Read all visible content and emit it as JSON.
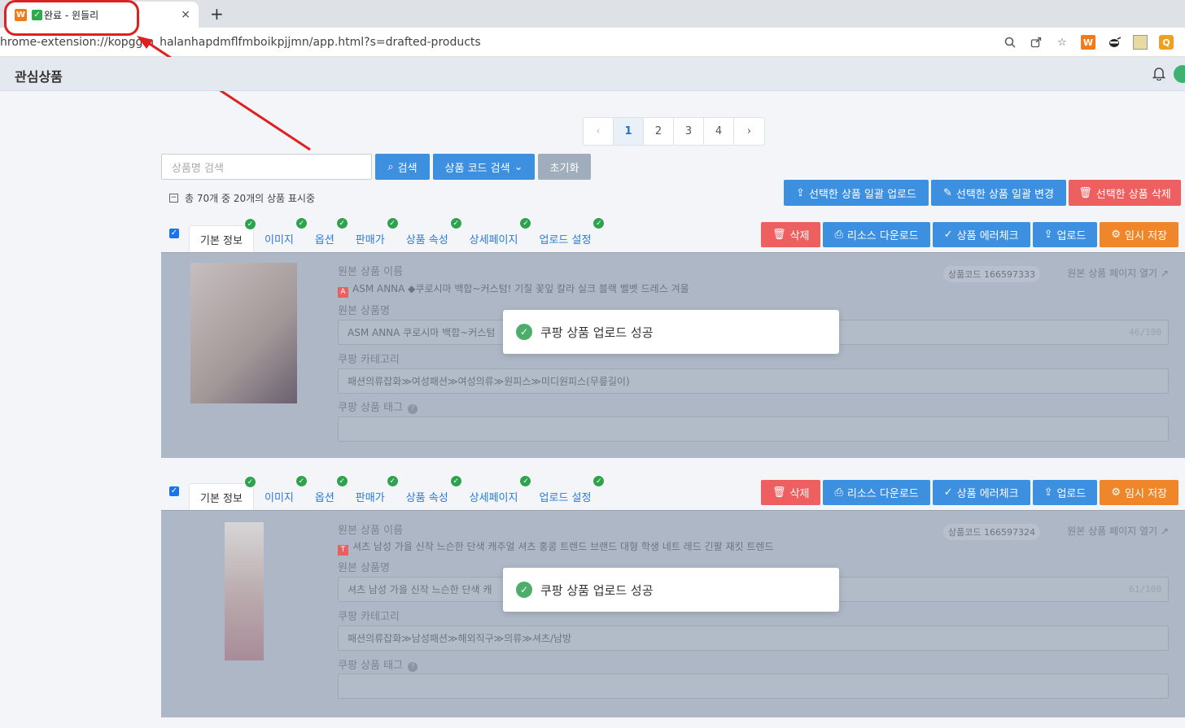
{
  "browser": {
    "tab_title": "완료 - 윈들리",
    "tab_close": "×",
    "new_tab": "+",
    "url": "hrome-extension://kopggm   halanhapdmflfmboikpjjmn/app.html?s=drafted-products",
    "favicon_letter": "W",
    "ext_letter_q": "Q",
    "annotation_color": "#e02020"
  },
  "header": {
    "title": "관심상품"
  },
  "pagination": {
    "prev": "‹",
    "pages": [
      "1",
      "2",
      "3",
      "4"
    ],
    "active": "1",
    "next": "›"
  },
  "search": {
    "placeholder": "상품명 검색",
    "search_button": "검색",
    "code_search_button": "상품 코드 검색",
    "reset_button": "초기화"
  },
  "summary": "총 70개 중 20개의 상품 표시중",
  "bulk_actions": {
    "upload": "선택한 상품 일괄 업로드",
    "edit": "선택한 상품 일괄 변경",
    "delete": "선택한 상품 삭제"
  },
  "card_tabs": [
    "기본 정보",
    "이미지",
    "옵션",
    "판매가",
    "상품 속성",
    "상세페이지",
    "업로드 설정"
  ],
  "card_actions": {
    "delete": "삭제",
    "download": "리소스 다운로드",
    "errorcheck": "상품 에러체크",
    "upload": "업로드",
    "save": "임시 저장"
  },
  "labels": {
    "original_name": "원본 상품 이름",
    "product_name": "원본 상품명",
    "category": "쿠팡 카테고리",
    "tags": "쿠팡 상품 태그",
    "open_page": "원본 상품 페이지 열기"
  },
  "products": [
    {
      "code": "상품코드 166597333",
      "original_name": "ASM ANNA ◆쿠로시마 백합~커스텀! 기질 꽃잎 칼라 실크 블랙 벨벳 드레스 겨울",
      "product_name": "ASM ANNA 쿠로시마 백합~커스텀",
      "counter": "46/100",
      "category": "패션의류잡화≫여성패션≫여성의류≫원피스≫미디원피스(무릎길이)",
      "toast": "쿠팡 상품 업로드 성공"
    },
    {
      "code": "상품코드 166597324",
      "original_name": "셔츠 남성 가을 신작 느슨한 단색 캐주얼 셔츠 홍콩 트렌드 브랜드 대형 학생 네트 레드 긴팔 재킷 트렌드",
      "product_name": "셔츠 남성 가을 신작 느슨한 단색 캐",
      "counter": "61/100",
      "category": "패션의류잡화≫남성패션≫해외직구≫의류≫셔츠/남방",
      "toast": "쿠팡 상품 업로드 성공"
    }
  ]
}
